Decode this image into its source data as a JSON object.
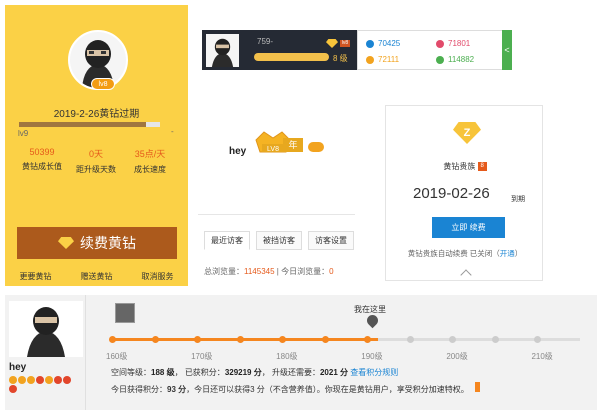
{
  "panel1": {
    "level_badge": "lv8",
    "expiry": "2019-2-26黄钻过期",
    "level": "lv9",
    "progress_fraction": 0.9,
    "stats": [
      {
        "value": "50399",
        "label": "黄钻成长值"
      },
      {
        "value": "0天",
        "label": "距升级天数"
      },
      {
        "value": "35点/天",
        "label": "成长速度"
      }
    ],
    "renew_button": "续费黄钻",
    "links": [
      "更要黄钻",
      "赠送黄钻",
      "取消服务"
    ],
    "colors": {
      "bg": "#fbd146",
      "button": "#ac5a1c",
      "stat_value": "#e55a1b"
    }
  },
  "panel2": {
    "user_number": "759-",
    "badge": "lv8",
    "grade": "8 级",
    "stats": [
      {
        "icon": "drop-icon",
        "value": "70425",
        "color": "#1a84d3"
      },
      {
        "icon": "heart-icon",
        "value": "71801",
        "color": "#e24b6b"
      },
      {
        "icon": "gold-icon",
        "value": "72111",
        "color": "#f2a31f"
      },
      {
        "icon": "leaf-icon",
        "value": "114882",
        "color": "#4caf50"
      }
    ],
    "tab_arrow": "<"
  },
  "panel3": {
    "username": "hey",
    "crown_text": "LV8",
    "year_badge": "年",
    "tabs": [
      "最近访客",
      "被挡访客",
      "访客设置"
    ],
    "visits": {
      "total_label": "总浏览量：",
      "total": "1145345",
      "today_label": "今日浏览量：",
      "today": "0"
    }
  },
  "panel4": {
    "title": "黄钻贵族",
    "title_badge": "8",
    "expiry_date": "2019-02-26",
    "expiry_suffix": "到期",
    "renew_button": "立即 续费",
    "auto_renew_label": "黄钻贵族自动续费 已关闭（",
    "auto_renew_link": "开通",
    "auto_renew_end": "）"
  },
  "panel5": {
    "username": "hey",
    "here_label": "我在这里",
    "progress_fraction": 0.568,
    "ticks": [
      "160级",
      "170级",
      "180级",
      "190级",
      "200级",
      "210级"
    ],
    "info": {
      "level_label": "空间等级：",
      "level": "188 级",
      "points_label": "已获积分：",
      "points": "329219 分",
      "upgrade_label": "升级还需要：",
      "upgrade": "2021 分",
      "rules_link": "查看积分规则"
    },
    "today": {
      "earned_label": "今日获得积分：",
      "earned": "93 分",
      "rest": "，今日还可以获得3 分（不含营养值）。你现在是黄钻用户，享受积分加速特权。"
    }
  }
}
